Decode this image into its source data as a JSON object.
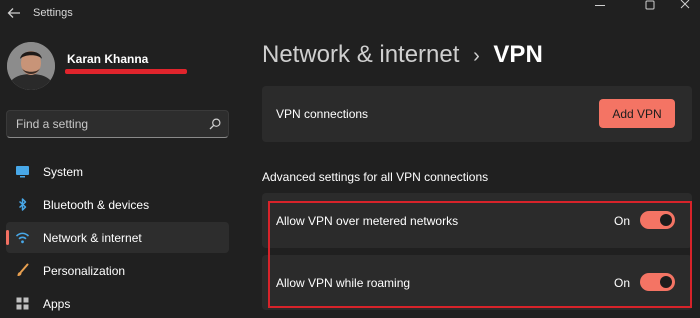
{
  "window": {
    "title": "Settings"
  },
  "user": {
    "name": "Karan Khanna"
  },
  "search": {
    "placeholder": "Find a setting"
  },
  "sidebar": {
    "items": [
      {
        "label": "System",
        "icon": "monitor-icon",
        "active": false
      },
      {
        "label": "Bluetooth & devices",
        "icon": "bluetooth-icon",
        "active": false
      },
      {
        "label": "Network & internet",
        "icon": "wifi-icon",
        "active": true
      },
      {
        "label": "Personalization",
        "icon": "brush-icon",
        "active": false
      },
      {
        "label": "Apps",
        "icon": "apps-grid-icon",
        "active": false
      }
    ]
  },
  "header": {
    "breadcrumb_parent": "Network & internet",
    "breadcrumb_separator": "›",
    "breadcrumb_current": "VPN"
  },
  "vpn_connections": {
    "label": "VPN connections",
    "add_button": "Add VPN"
  },
  "advanced": {
    "heading": "Advanced settings for all VPN connections",
    "settings": [
      {
        "label": "Allow VPN over metered networks",
        "state": "On",
        "enabled": true
      },
      {
        "label": "Allow VPN while roaming",
        "state": "On",
        "enabled": true
      }
    ]
  },
  "colors": {
    "accent": "#f47464",
    "background": "#202020",
    "card": "#2b2b2b",
    "annotation_red": "#d7232a"
  }
}
